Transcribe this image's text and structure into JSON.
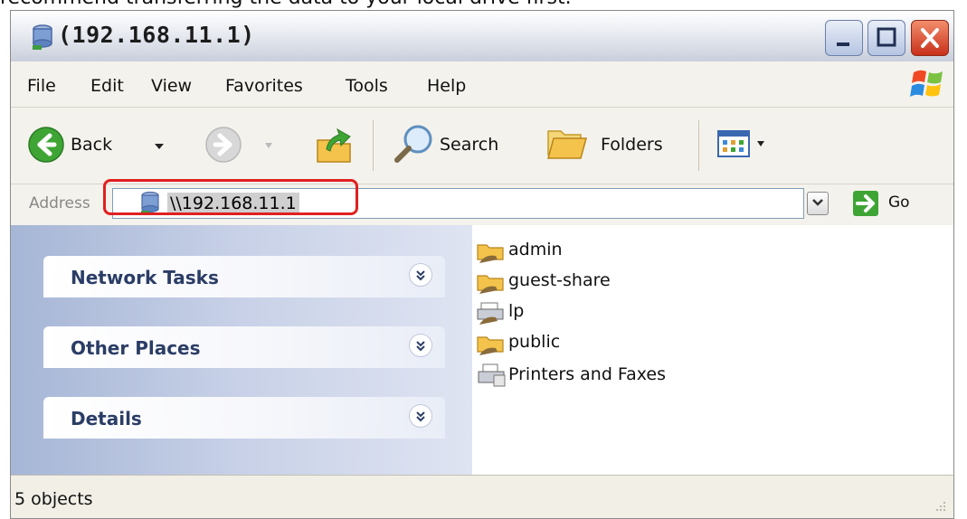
{
  "header_text": "recommend transferring the data to your local drive first.",
  "window": {
    "title": "(192.168.11.1)",
    "title_icon": "network-drive-icon",
    "controls": [
      "minimize-icon",
      "maximize-icon",
      "close-icon"
    ]
  },
  "menu": {
    "file": "File",
    "edit": "Edit",
    "view": "View",
    "favorites": "Favorites",
    "tools": "Tools",
    "help": "Help"
  },
  "toolbar": {
    "back": "Back",
    "search": "Search",
    "folders": "Folders",
    "icons": [
      "back-arrow-icon",
      "forward-arrow-icon",
      "up-folder-icon",
      "magnifier-icon",
      "folders-icon",
      "views-icon"
    ]
  },
  "address": {
    "label": "Address",
    "value": "\\\\192.168.11.1",
    "go": "Go"
  },
  "tasks": [
    {
      "label": "Network Tasks"
    },
    {
      "label": "Other Places"
    },
    {
      "label": "Details"
    }
  ],
  "files": [
    {
      "name": "admin",
      "icon": "shared-folder-icon"
    },
    {
      "name": "guest-share",
      "icon": "shared-folder-icon"
    },
    {
      "name": "lp",
      "icon": "shared-printer-icon"
    },
    {
      "name": "public",
      "icon": "shared-folder-icon"
    },
    {
      "name": "Printers and Faxes",
      "icon": "printers-faxes-icon"
    }
  ],
  "status": {
    "text": "5 objects"
  },
  "colors": {
    "highlight_border": "#e02020",
    "task_pane": "#a6b6d6",
    "task_label": "#2b3d66"
  }
}
